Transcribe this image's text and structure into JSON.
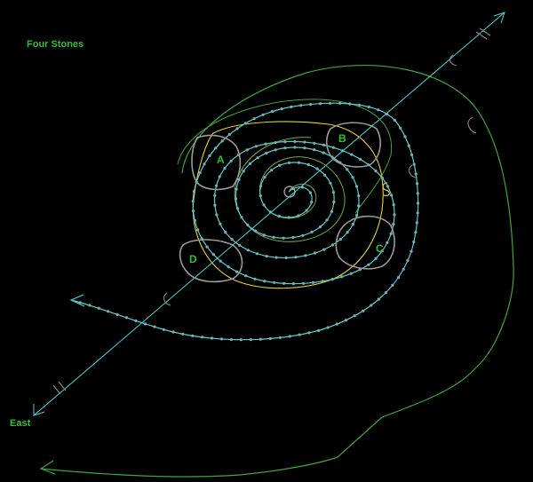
{
  "title": "Four Stones",
  "direction_label": "East",
  "stones": [
    {
      "label": "A"
    },
    {
      "label": "B"
    },
    {
      "label": "C"
    },
    {
      "label": "D"
    }
  ],
  "colors": {
    "background": "#000000",
    "title": "#2fbf3a",
    "label": "#2fbf3a",
    "spiral": "#4fd2d6",
    "spiral_dots": "#8aa8a8",
    "outer_curve": "#3fa53f",
    "yellow_loop": "#e2d23a",
    "inner_green": "#7aa83a",
    "stone_outline": "#9a9a9a",
    "axis": "#4fd2d6",
    "hatch_marks": "#8a8a8a"
  }
}
